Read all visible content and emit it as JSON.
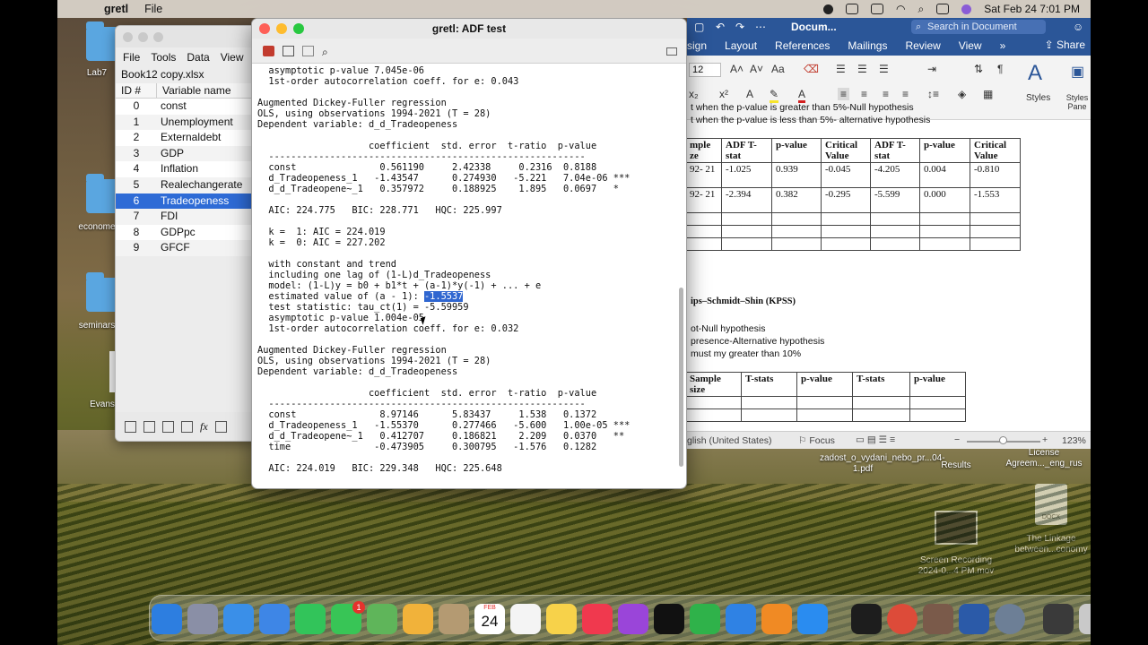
{
  "menubar": {
    "app_name": "gretl",
    "file_menu": "File",
    "clock": "Sat Feb 24  7:01 PM"
  },
  "desktop": {
    "items": [
      {
        "label": "Lab7"
      },
      {
        "label": "econome"
      },
      {
        "label": "seminars"
      },
      {
        "label": "Evans"
      },
      {
        "label": "zadost_o_vydani_nebo_pr...04-1.pdf"
      },
      {
        "label": "Results"
      },
      {
        "label": "License Agreem..._eng_rus"
      },
      {
        "label": "Screen Recording 2024-0...4 PM.mov"
      },
      {
        "label": "The Linkage between...conomy"
      }
    ],
    "docx_tag": "DOCX"
  },
  "data_window": {
    "menu": [
      "File",
      "Tools",
      "Data",
      "View",
      "A"
    ],
    "filename": "Book12 copy.xlsx",
    "col_id": "ID #",
    "col_name": "Variable name",
    "rows": [
      {
        "id": "0",
        "name": "const"
      },
      {
        "id": "1",
        "name": "Unemployment"
      },
      {
        "id": "2",
        "name": "Externaldebt"
      },
      {
        "id": "3",
        "name": "GDP"
      },
      {
        "id": "4",
        "name": "Inflation"
      },
      {
        "id": "5",
        "name": "Realechangerate"
      },
      {
        "id": "6",
        "name": "Tradeopeness"
      },
      {
        "id": "7",
        "name": "FDI"
      },
      {
        "id": "8",
        "name": "GDPpc"
      },
      {
        "id": "9",
        "name": "GFCF"
      }
    ],
    "selected_index": 6,
    "fx_label": "fx"
  },
  "adf_window": {
    "title": "gretl: ADF test",
    "lines": [
      "  asymptotic p-value 7.045e-06",
      "  1st-order autocorrelation coeff. for e: 0.043",
      "",
      "Augmented Dickey-Fuller regression",
      "OLS, using observations 1994-2021 (T = 28)",
      "Dependent variable: d_d_Tradeopeness",
      "",
      "                    coefficient  std. error  t-ratio  p-value",
      "  ---------------------------------------------------------",
      "  const               0.561190     2.42338     0.2316  0.8188",
      "  d_Tradeopeness_1   -1.43547      0.274930   -5.221   7.04e-06 ***",
      "  d_d_Tradeopene~_1   0.357972     0.188925    1.895   0.0697   *",
      "",
      "  AIC: 224.775   BIC: 228.771   HQC: 225.997",
      "",
      "  k =  1: AIC = 224.019",
      "  k =  0: AIC = 227.202",
      "",
      "  with constant and trend",
      "  including one lag of (1-L)d_Tradeopeness",
      "  model: (1-L)y = b0 + b1*t + (a-1)*y(-1) + ... + e",
      "  estimated value of (a - 1): ",
      "  test statistic: tau_ct(1) = -5.59959",
      "  asymptotic p-value 1.004e-05",
      "  1st-order autocorrelation coeff. for e: 0.032",
      "",
      "Augmented Dickey-Fuller regression",
      "OLS, using observations 1994-2021 (T = 28)",
      "Dependent variable: d_d_Tradeopeness",
      "",
      "                    coefficient  std. error  t-ratio  p-value",
      "  ---------------------------------------------------------",
      "  const               8.97146      5.83437     1.538   0.1372",
      "  d_Tradeopeness_1   -1.55370      0.277466   -5.600   1.00e-05 ***",
      "  d_d_Tradeopene~_1   0.412707     0.186821    2.209   0.0370   **",
      "  time               -0.473905     0.300795   -1.576   0.1282",
      "",
      "  AIC: 224.019   BIC: 229.348   HQC: 225.648"
    ],
    "highlighted_value": "-1.5537",
    "highlighted_line_index": 21
  },
  "word_window": {
    "doc_title": "Docum...",
    "search_placeholder": "Search in Document",
    "tabs": [
      "sign",
      "Layout",
      "References",
      "Mailings",
      "Review",
      "View",
      "»"
    ],
    "share_label": "Share",
    "font_size": "12",
    "styles_label": "Styles",
    "styles_pane_label": "Styles Pane",
    "note1": "t when the p-value is greater than 5%-Null hypothesis",
    "note2": "t when the p-value is less than 5%- alternative hypothesis",
    "adf_table": {
      "headers": [
        "mple ze",
        "ADF T-stat",
        "p-value",
        "Critical Value",
        "ADF T-stat",
        "p-value",
        "Critical Value"
      ],
      "rows": [
        [
          "92- 21",
          "-1.025",
          "0.939",
          "-0.045",
          "-4.205",
          "0.004",
          "-0.810"
        ],
        [
          "92- 21",
          "-2.394",
          "0.382",
          "-0.295",
          "-5.599",
          "0.000",
          "-1.553"
        ],
        [
          "",
          "",
          "",
          "",
          "",
          "",
          ""
        ],
        [
          "",
          "",
          "",
          "",
          "",
          "",
          ""
        ],
        [
          "",
          "",
          "",
          "",
          "",
          "",
          ""
        ]
      ]
    },
    "kpss_heading": "ips–Schmidt–Shin (KPSS)",
    "kpss_note1": "ot-Null hypothesis",
    "kpss_note2": "presence-Alternative hypothesis",
    "kpss_note3": "must my greater than 10%",
    "kpss_table": {
      "headers": [
        "Sample size",
        "T-stats",
        "p-value",
        "T-stats",
        "p-value"
      ],
      "rows": [
        [
          "",
          "",
          "",
          "",
          ""
        ],
        [
          "",
          "",
          "",
          "",
          ""
        ]
      ]
    },
    "status_language": "glish (United States)",
    "focus_label": "Focus",
    "zoom": "123%"
  },
  "dock": {
    "calendar_month": "FEB",
    "calendar_day": "24",
    "messages_badge": "1"
  }
}
